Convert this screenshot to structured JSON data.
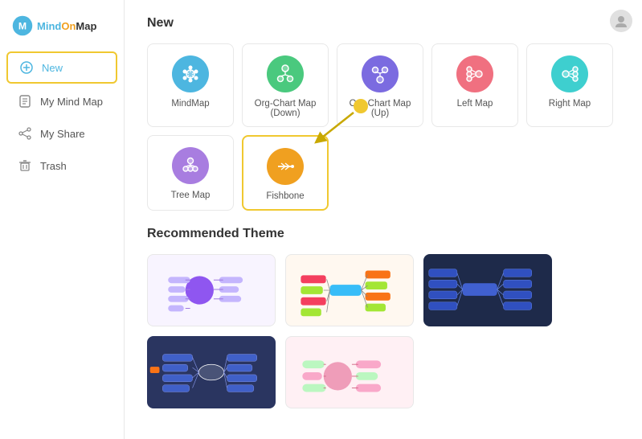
{
  "logo": {
    "text_mind": "Mind",
    "text_on": "On",
    "text_map": "Map"
  },
  "sidebar": {
    "items": [
      {
        "id": "new",
        "label": "New",
        "icon": "plus",
        "active": true
      },
      {
        "id": "my-mind-map",
        "label": "My Mind Map",
        "icon": "file",
        "active": false
      },
      {
        "id": "my-share",
        "label": "My Share",
        "icon": "share",
        "active": false
      },
      {
        "id": "trash",
        "label": "Trash",
        "icon": "trash",
        "active": false
      }
    ]
  },
  "main": {
    "new_section_title": "New",
    "maps": [
      {
        "id": "mindmap",
        "label": "MindMap",
        "color": "#4db6e0",
        "icon": "⚙"
      },
      {
        "id": "org-chart-down",
        "label": "Org-Chart Map (Down)",
        "color": "#4ac97e",
        "icon": "⊕"
      },
      {
        "id": "org-chart-up",
        "label": "Org-Chart Map (Up)",
        "color": "#7b6be0",
        "icon": "⍢"
      },
      {
        "id": "left-map",
        "label": "Left Map",
        "color": "#f07080",
        "icon": "⊕"
      },
      {
        "id": "right-map",
        "label": "Right Map",
        "color": "#3ecfcf",
        "icon": "⊕"
      },
      {
        "id": "tree-map",
        "label": "Tree Map",
        "color": "#a87de0",
        "icon": "⊛"
      },
      {
        "id": "fishbone",
        "label": "Fishbone",
        "color": "#f0a020",
        "icon": "⊛",
        "highlighted": true
      }
    ],
    "recommended_title": "Recommended Theme",
    "themes": [
      {
        "id": "theme1",
        "dark": false
      },
      {
        "id": "theme2",
        "dark": false
      },
      {
        "id": "theme3",
        "dark": true
      },
      {
        "id": "theme4",
        "dark": true
      },
      {
        "id": "theme5",
        "dark": false
      }
    ]
  }
}
